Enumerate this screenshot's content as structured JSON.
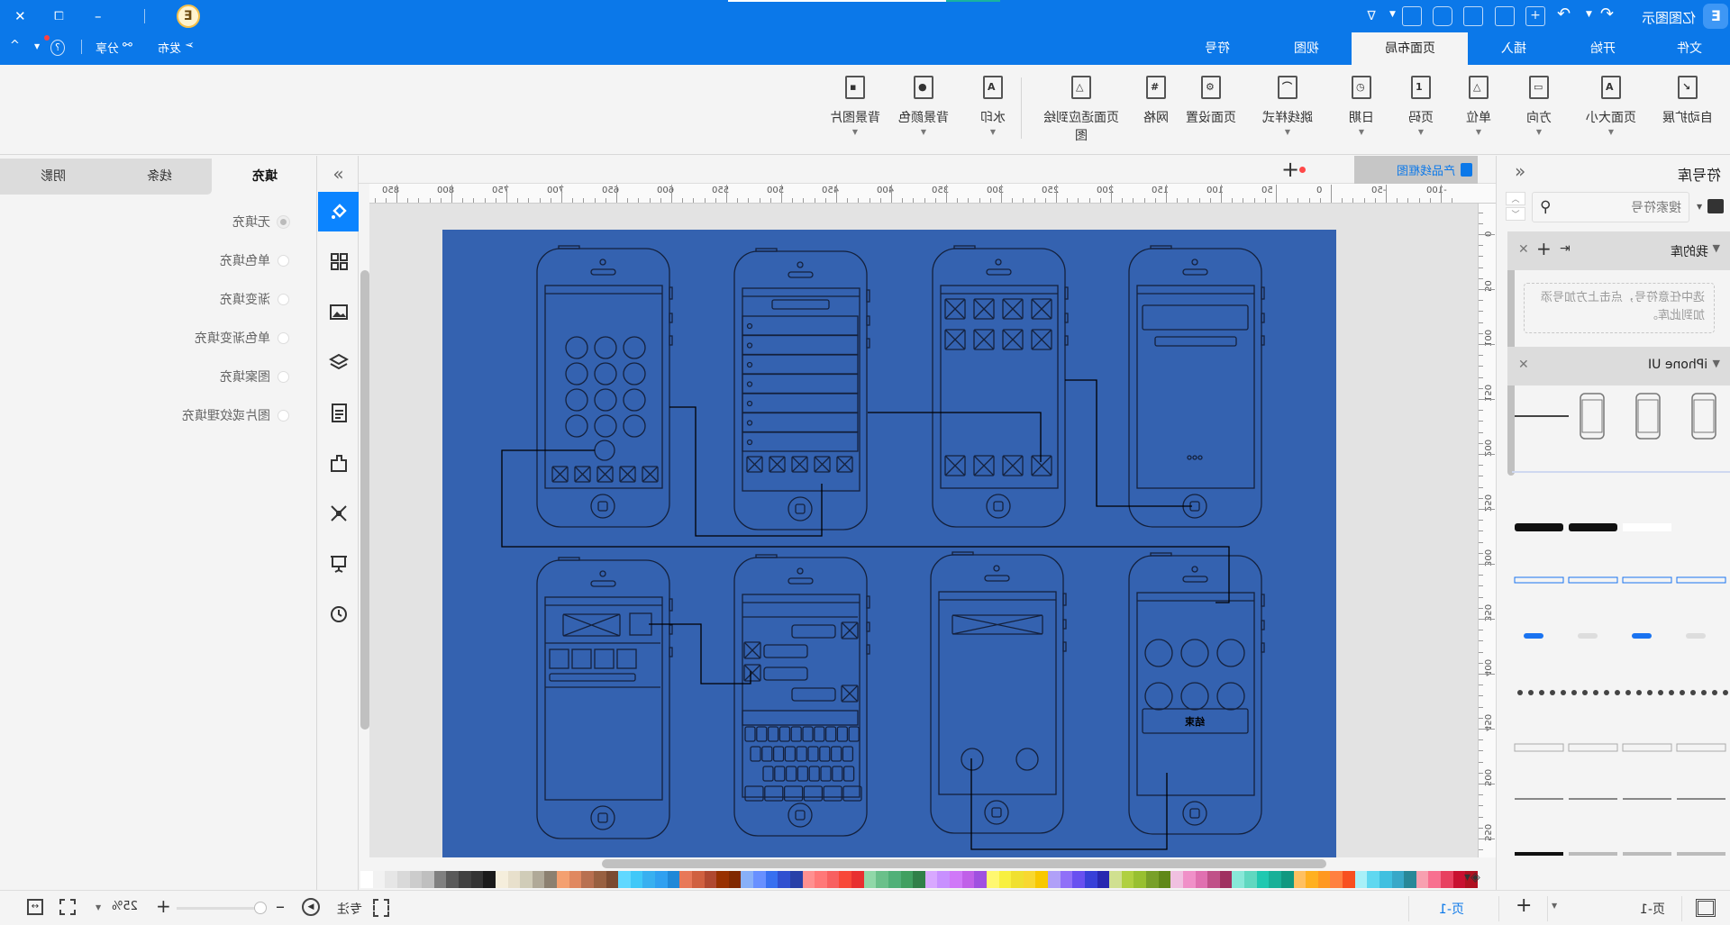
{
  "app": {
    "title": "亿图图示",
    "brand_color": "#0b78e9"
  },
  "window": {
    "close": "✕",
    "restore": "❐",
    "minimize": "–"
  },
  "header": {
    "publish": "发布",
    "share": "分享",
    "help": "?",
    "collapse": "^",
    "tabs": [
      {
        "label": "文件"
      },
      {
        "label": "开始"
      },
      {
        "label": "插入"
      },
      {
        "label": "页面布局",
        "active": true
      },
      {
        "label": "视图"
      },
      {
        "label": "符号"
      }
    ]
  },
  "ribbon": {
    "items": [
      {
        "label": "自动扩展",
        "icon": "auto-expand-icon",
        "glyph": "↘",
        "dropdown": false
      },
      {
        "label": "页面大小",
        "icon": "page-size-icon",
        "glyph": "A",
        "dropdown": true
      },
      {
        "label": "方向",
        "icon": "orientation-icon",
        "glyph": "▭",
        "dropdown": true
      },
      {
        "label": "单位",
        "icon": "unit-icon",
        "glyph": "△",
        "dropdown": true
      },
      {
        "label": "页码",
        "icon": "page-number-icon",
        "glyph": "1",
        "dropdown": true
      },
      {
        "label": "日期",
        "icon": "date-icon",
        "glyph": "◷",
        "dropdown": true
      },
      {
        "label": "跳线样式",
        "icon": "jump-line-icon",
        "glyph": "⌒",
        "dropdown": true
      },
      {
        "label": "页面设置",
        "icon": "page-setup-icon",
        "glyph": "⚙",
        "dropdown": false
      },
      {
        "label": "网格",
        "icon": "grid-icon",
        "glyph": "#",
        "dropdown": false
      },
      {
        "label": "页面适应到绘图",
        "icon": "fit-to-drawing-icon",
        "glyph": "△",
        "dropdown": false
      },
      {
        "label": "水印",
        "icon": "watermark-icon",
        "glyph": "A",
        "dropdown": true
      },
      {
        "label": "背景颜色",
        "icon": "background-color-icon",
        "glyph": "●",
        "dropdown": true
      },
      {
        "label": "背景图片",
        "icon": "background-image-icon",
        "glyph": "▪",
        "dropdown": true
      }
    ]
  },
  "fill_panel": {
    "tabs": [
      "填充",
      "线条",
      "阴影"
    ],
    "active_tab": "填充",
    "options": [
      {
        "label": "无填充",
        "checked": true
      },
      {
        "label": "单色填充",
        "checked": false
      },
      {
        "label": "渐变填充",
        "checked": false
      },
      {
        "label": "单色渐变填充",
        "checked": false
      },
      {
        "label": "图案填充",
        "checked": false
      },
      {
        "label": "图片或纹理填充",
        "checked": false
      }
    ]
  },
  "side_icons": [
    "fill-icon",
    "grid-layout-icon",
    "image-icon",
    "layers-icon",
    "document-icon",
    "puzzle-icon",
    "connect-icon",
    "presentation-icon",
    "history-icon"
  ],
  "document": {
    "tab": "产品线框图",
    "unsaved": true,
    "add_tab": "+"
  },
  "ruler": {
    "h_labels": [
      "-100",
      "-50",
      "0",
      "50",
      "100",
      "150",
      "200",
      "250",
      "300",
      "350",
      "400",
      "450",
      "500",
      "550",
      "600",
      "650",
      "700",
      "750",
      "800",
      "850"
    ],
    "v_labels": [
      "0",
      "50",
      "100",
      "150",
      "200",
      "250",
      "300",
      "350",
      "400",
      "450",
      "500",
      "550"
    ]
  },
  "canvas": {
    "page_color": "#3462b0",
    "end_call_label": "结束"
  },
  "palette": [
    "#ffffff",
    "#f2f2f2",
    "#e6e6e6",
    "#d9d9d9",
    "#cccccc",
    "#bfbfbf",
    "#808080",
    "#595959",
    "#404040",
    "#333333",
    "#1a1a1a",
    "#f5eedc",
    "#e8e0cc",
    "#d0ccb8",
    "#b0a998",
    "#8c8070",
    "#f4a070",
    "#e08860",
    "#b87050",
    "#986040",
    "#7a4a30",
    "#60d8ff",
    "#40c8f8",
    "#38b0f0",
    "#30a0f0",
    "#2088d8",
    "#e87858",
    "#d06040",
    "#b04830",
    "#983000",
    "#802800",
    "#88b0f8",
    "#6890ff",
    "#3870f0",
    "#3050d0",
    "#2840a8",
    "#ff9090",
    "#ff7878",
    "#f86060",
    "#f84838",
    "#e83030",
    "#90d8a8",
    "#6ac08a",
    "#50b078",
    "#40a060",
    "#308048",
    "#d8a8ff",
    "#c890ff",
    "#d078f8",
    "#c060e8",
    "#a050e0",
    "#fff870",
    "#f8f040",
    "#f0e030",
    "#f8d830",
    "#f8c800",
    "#b0a0f8",
    "#9070f8",
    "#6850f0",
    "#3840d8",
    "#2828b0",
    "#d0e090",
    "#b0d040",
    "#98c030",
    "#78a028",
    "#608818",
    "#f0c0e0",
    "#f090c8",
    "#e070b0",
    "#c05088",
    "#a03060",
    "#88e8d8",
    "#60d8c0",
    "#20c8b0",
    "#18b098",
    "#109880",
    "#ffc060",
    "#ffb020",
    "#ff9820",
    "#ff8040",
    "#f85020",
    "#a8f0f8",
    "#60d8f0",
    "#40c0e0",
    "#38a8c8",
    "#288898",
    "#f8a0b0",
    "#f87090",
    "#e84060",
    "#c81030",
    "#b01020"
  ],
  "symbol_library": {
    "title": "符号库",
    "search_placeholder": "搜索符号",
    "my_library": "我的库",
    "my_library_hint": "选中任意符号，点击上方加号添加到此库。",
    "iphone_section": "iPhone UI"
  },
  "status": {
    "zoom": "25%",
    "zoom_level": 0.25,
    "focus": "专注",
    "page_current": "页-1",
    "page_tab": "页-1",
    "add_page": "+"
  }
}
